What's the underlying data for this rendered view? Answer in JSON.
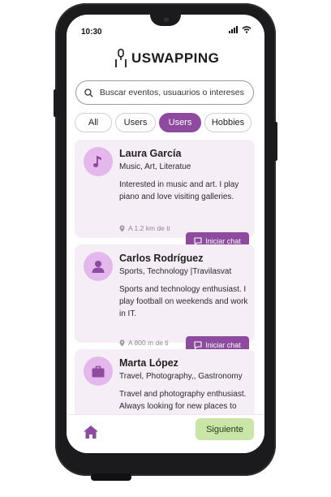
{
  "status_bar": {
    "time": "10:30"
  },
  "app": {
    "brand": "USWAPPING"
  },
  "search": {
    "placeholder": "Buscar eventos, usuaurios o intereses"
  },
  "filters": [
    {
      "label": "All",
      "active": false
    },
    {
      "label": "Users",
      "active": false
    },
    {
      "label": "Users",
      "active": true
    },
    {
      "label": "Hobbies",
      "active": false
    }
  ],
  "users": [
    {
      "name": "Laura García",
      "interests": "Music, Art, Literatue",
      "bio": "Interested in music and art. I play piano and love visiting galleries.",
      "distance": "A 1.2 km de ti",
      "icon": "music-note-icon",
      "chat_label": "Iniciar chat"
    },
    {
      "name": "Carlos Rodríguez",
      "interests": "Sports, Technology |Travilasvat",
      "bio": "Sports and technology enthusiast. I play football on weekends and work in IT.",
      "distance": "A 800 m de ti",
      "icon": "person-icon",
      "chat_label": "Iniciar chat"
    },
    {
      "name": "Marta López",
      "interests": "Travel, Photography,, Gastronomy",
      "bio": "Travel and photography enthusiast. Always looking for new places to",
      "distance": "",
      "icon": "suitcase-icon",
      "chat_label": ""
    }
  ],
  "bottom_nav": {
    "next_label": "Siguiente",
    "home_icon": "home-icon"
  },
  "colors": {
    "accent": "#8d4a9e",
    "avatar_bg": "#e4b8ec",
    "card_bg": "#f6eef7",
    "next_bg": "#c9e5a8"
  }
}
